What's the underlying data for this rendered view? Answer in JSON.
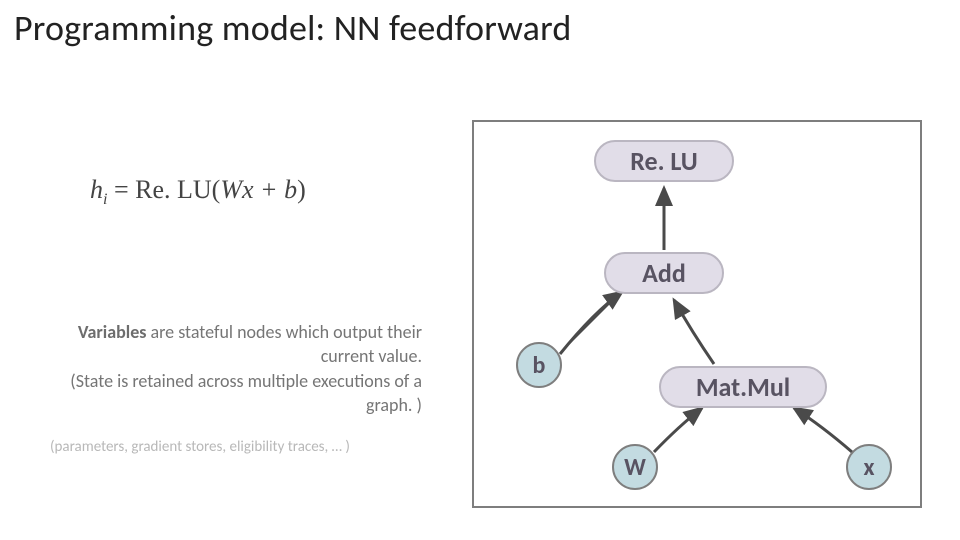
{
  "title": "Programming model: NN feedforward",
  "equation": {
    "lhs_var": "h",
    "lhs_sub": "i",
    "op": "Re. LU",
    "inner": "Wx + b"
  },
  "blurb": {
    "bold": "Variables",
    "rest1": " are stateful nodes which output their current value.",
    "rest2": "(State is retained across multiple executions of a graph. )"
  },
  "footnote": "(parameters, gradient stores, eligibility traces, … )",
  "diagram": {
    "nodes": {
      "relu": "Re. LU",
      "add": "Add",
      "matmul": "Mat.Mul",
      "b": "b",
      "w": "W",
      "x": "x"
    }
  }
}
